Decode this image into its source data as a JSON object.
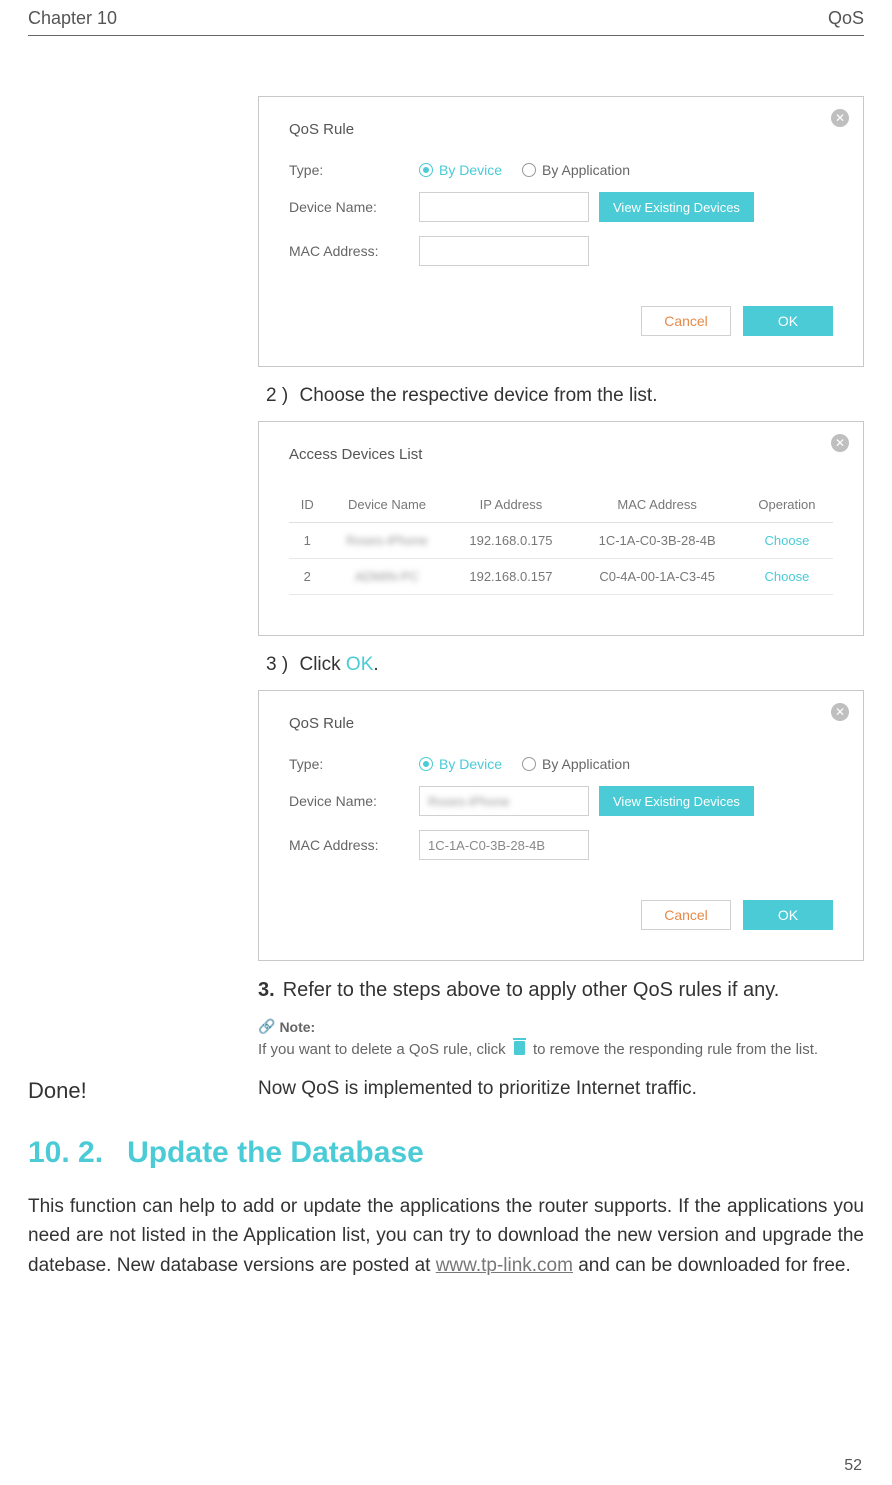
{
  "header": {
    "chapter": "Chapter 10",
    "title": "QoS"
  },
  "page_number": "52",
  "panel_qos_1": {
    "title": "QoS Rule",
    "labels": {
      "type": "Type:",
      "device_name": "Device Name:",
      "mac": "MAC Address:"
    },
    "radio": {
      "by_device": "By Device",
      "by_app": "By Application"
    },
    "view_btn": "View Existing Devices",
    "cancel": "Cancel",
    "ok": "OK"
  },
  "step2": {
    "prefix": "2 )",
    "text": "Choose the respective device from the list."
  },
  "panel_devices": {
    "title": "Access Devices List",
    "headers": {
      "id": "ID",
      "name": "Device Name",
      "ip": "IP Address",
      "mac": "MAC Address",
      "op": "Operation"
    },
    "rows": [
      {
        "id": "1",
        "name": "Roses-iPhone",
        "ip": "192.168.0.175",
        "mac": "1C-1A-C0-3B-28-4B",
        "op": "Choose"
      },
      {
        "id": "2",
        "name": "ADMIN-PC",
        "ip": "192.168.0.157",
        "mac": "C0-4A-00-1A-C3-45",
        "op": "Choose"
      }
    ]
  },
  "step3click": {
    "prefix": "3 )",
    "pre": "Click ",
    "ok": "OK",
    "post": "."
  },
  "panel_qos_2": {
    "title": "QoS Rule",
    "labels": {
      "type": "Type:",
      "device_name": "Device Name:",
      "mac": "MAC Address:"
    },
    "radio": {
      "by_device": "By Device",
      "by_app": "By Application"
    },
    "device_value": "Roses-iPhone",
    "mac_value": "1C-1A-C0-3B-28-4B",
    "view_btn": "View Existing Devices",
    "cancel": "Cancel",
    "ok": "OK"
  },
  "step_refer": {
    "num": "3.",
    "text": "Refer to the steps above to apply other QoS rules if any."
  },
  "note": {
    "label": "Note:",
    "pre": "If you want to delete a QoS rule, click ",
    "post": " to remove the responding rule from the list."
  },
  "done": {
    "label": "Done!",
    "text": "Now QoS is implemented to prioritize Internet traffic."
  },
  "section": {
    "num": "10. 2.",
    "title": "Update the Database"
  },
  "para": {
    "p1": "This function can help to add or update the applications the router supports. If the applications you need are not listed in the Application list, you can try to download the new version and upgrade the datebase. New database versions are posted at ",
    "link": "www.tp-link.com",
    "p2": " and can be downloaded for free."
  }
}
